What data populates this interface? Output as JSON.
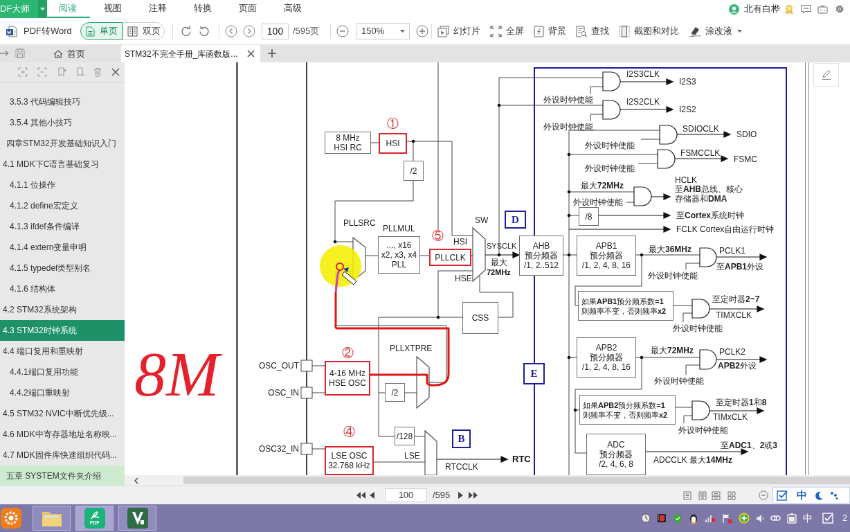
{
  "app_menu": {
    "label": "DF大师"
  },
  "menu_tabs": [
    {
      "label": "阅读",
      "selected": true
    },
    {
      "label": "视图",
      "selected": false
    },
    {
      "label": "注释",
      "selected": false
    },
    {
      "label": "转换",
      "selected": false
    },
    {
      "label": "页面",
      "selected": false
    },
    {
      "label": "高级",
      "selected": false
    }
  ],
  "account": {
    "name": "北有白桦"
  },
  "toolbar": {
    "convert_button": "PDF转Word",
    "page_layouts": [
      {
        "label": "单页",
        "selected": true
      },
      {
        "label": "双页",
        "selected": false
      }
    ],
    "page_field": {
      "value": "100"
    },
    "page_total": "/595页",
    "zoom_field": {
      "value": "150%"
    },
    "tools": [
      {
        "label": "幻灯片",
        "dropdown": false
      },
      {
        "label": "全屏",
        "dropdown": false
      },
      {
        "label": "背景",
        "dropdown": false
      },
      {
        "label": "查找",
        "dropdown": false
      },
      {
        "label": "截图和对比",
        "dropdown": false
      },
      {
        "label": "涂改液",
        "dropdown": true
      }
    ]
  },
  "tabs": [
    {
      "kind": "home",
      "label": "首页",
      "selected": false
    },
    {
      "kind": "document",
      "label": "STM32不完全手册_库函数版...",
      "selected": true
    }
  ],
  "outline": {
    "continued_items": [
      {
        "label": "3.5.3 代码编辑技巧",
        "selected": false,
        "hovered": false
      },
      {
        "label": "3.5.4 其他小技巧",
        "selected": false,
        "hovered": false
      }
    ],
    "items": [
      {
        "label": "四章STM32开发基础知识入门",
        "selected": false,
        "hovered": false,
        "children": [
          {
            "label": "4.1 MDK下C语言基础复习",
            "selected": false,
            "hovered": false,
            "children": [
              {
                "label": "4.1.1 位操作",
                "selected": false,
                "hovered": false
              },
              {
                "label": "4.1.2 define宏定义",
                "selected": false,
                "hovered": false
              },
              {
                "label": "4.1.3 ifdef条件编译",
                "selected": false,
                "hovered": false
              },
              {
                "label": "4.1.4 extern变量申明",
                "selected": false,
                "hovered": false
              },
              {
                "label": "4.1.5 typedef类型别名",
                "selected": false,
                "hovered": false
              },
              {
                "label": "4.1.6 结构体",
                "selected": false,
                "hovered": false
              }
            ]
          },
          {
            "label": "4.2 STM32系统架构",
            "selected": false,
            "hovered": false
          },
          {
            "label": "4.3 STM32时钟系统",
            "selected": true,
            "hovered": false
          },
          {
            "label": "4.4 端口复用和重映射",
            "selected": false,
            "hovered": false,
            "children": [
              {
                "label": "4.4.1端口复用功能",
                "selected": false,
                "hovered": false
              },
              {
                "label": "4.4.2端口重映射",
                "selected": false,
                "hovered": false
              }
            ]
          },
          {
            "label": "4.5 STM32 NVIC中断优先级...",
            "selected": false,
            "hovered": false
          },
          {
            "label": "4.6 MDK中寄存器地址名称映...",
            "selected": false,
            "hovered": false
          },
          {
            "label": "4.7 MDK固件库快速组织代码...",
            "selected": false,
            "hovered": false
          }
        ]
      },
      {
        "label": "五章 SYSTEM文件夹介绍",
        "selected": false,
        "hovered": true
      }
    ]
  },
  "document": {
    "ink_note": "8M",
    "clock_diagram": {
      "parts": [
        {
          "kind": "box",
          "lines": [
            "8 MHz",
            "HSI RC"
          ],
          "highlighted": false
        },
        {
          "kind": "marker",
          "text": "①"
        },
        {
          "kind": "box",
          "lines": [
            "HSI"
          ],
          "highlighted": true
        },
        {
          "kind": "box",
          "lines": [
            "/2"
          ],
          "highlighted": false
        },
        {
          "kind": "label",
          "text": "PLLSRC"
        },
        {
          "kind": "label",
          "text": "PLLMUL"
        },
        {
          "kind": "box",
          "lines": [
            "..., x16",
            "x2, x3, x4",
            "PLL"
          ],
          "highlighted": false
        },
        {
          "kind": "marker",
          "text": "⑤"
        },
        {
          "kind": "box",
          "lines": [
            "PLLCLK"
          ],
          "highlighted": true
        },
        {
          "kind": "label",
          "text": "SW"
        },
        {
          "kind": "label",
          "text": "HSI"
        },
        {
          "kind": "label",
          "text": "HSE"
        },
        {
          "kind": "label",
          "text": "SYSCLK"
        },
        {
          "kind": "label",
          "text": "最大"
        },
        {
          "kind": "strong",
          "text": "72MHz"
        },
        {
          "kind": "region",
          "text": "D"
        },
        {
          "kind": "box",
          "lines": [
            "CSS"
          ],
          "highlighted": false
        },
        {
          "kind": "marker",
          "text": "②"
        },
        {
          "kind": "pin",
          "text": "OSC_OUT"
        },
        {
          "kind": "pin",
          "text": "OSC_IN"
        },
        {
          "kind": "box",
          "lines": [
            "4-16 MHz",
            "HSE OSC"
          ],
          "highlighted": true
        },
        {
          "kind": "label",
          "text": "PLLXTPRE"
        },
        {
          "kind": "box",
          "lines": [
            "/2"
          ],
          "highlighted": false
        },
        {
          "kind": "marker",
          "text": "④"
        },
        {
          "kind": "pin",
          "text": "OSC32_IN"
        },
        {
          "kind": "box",
          "lines": [
            "LSE OSC",
            "32.768 kHz"
          ],
          "highlighted": true
        },
        {
          "kind": "box",
          "lines": [
            "/128"
          ],
          "highlighted": false
        },
        {
          "kind": "label",
          "text": "LSE"
        },
        {
          "kind": "label",
          "text": "RTCCLK"
        },
        {
          "kind": "strong",
          "text": "RTC"
        },
        {
          "kind": "region",
          "text": "B"
        },
        {
          "kind": "box",
          "lines": [
            "AHB",
            "预分频器",
            "/1, 2..512"
          ],
          "highlighted": false
        },
        {
          "kind": "region",
          "text": "E"
        },
        {
          "kind": "label",
          "text": "I2S3CLK"
        },
        {
          "kind": "label",
          "text": "I2S3"
        },
        {
          "kind": "label",
          "text": "外设时钟使能"
        },
        {
          "kind": "label",
          "text": "I2S2CLK"
        },
        {
          "kind": "label",
          "text": "I2S2"
        },
        {
          "kind": "label",
          "text": "外设时钟使能"
        },
        {
          "kind": "label",
          "text": "SDIOCLK"
        },
        {
          "kind": "label",
          "text": "SDIO"
        },
        {
          "kind": "label",
          "text": "外设时钟使能"
        },
        {
          "kind": "label",
          "text": "FSMCCLK"
        },
        {
          "kind": "label",
          "text": "FSMC"
        },
        {
          "kind": "label",
          "text": "外设时钟使能"
        },
        {
          "kind": "label",
          "text": "最大**72MHz**"
        },
        {
          "kind": "label",
          "text": "外设时钟使能"
        },
        {
          "kind": "label",
          "text": "HCLK"
        },
        {
          "kind": "label",
          "text": "至**AHB**总线、核心"
        },
        {
          "kind": "label",
          "text": "存储器和**DMA**"
        },
        {
          "kind": "box",
          "lines": [
            "/8"
          ],
          "highlighted": false
        },
        {
          "kind": "label",
          "text": "至**Cortex**系统时钟"
        },
        {
          "kind": "label",
          "text": "FCLK Cortex自由运行时钟"
        },
        {
          "kind": "box",
          "lines": [
            "APB1",
            "预分频器",
            "/1, 2, 4, 8, 16"
          ],
          "highlighted": false
        },
        {
          "kind": "label",
          "text": "最大**36MHz**"
        },
        {
          "kind": "label",
          "text": "PCLK1"
        },
        {
          "kind": "label",
          "text": "至**APB1**外设"
        },
        {
          "kind": "label",
          "text": "外设时钟使能"
        },
        {
          "kind": "box",
          "lines": [
            "如果**APB1**预分频系数**=1**",
            "则频率不变，否则频率**x2**"
          ],
          "highlighted": false
        },
        {
          "kind": "label",
          "text": "至定时器**2~7**"
        },
        {
          "kind": "label",
          "text": "TIMXCLK"
        },
        {
          "kind": "label",
          "text": "外设时钟使能"
        },
        {
          "kind": "box",
          "lines": [
            "APB2",
            "预分频器",
            "/1, 2, 4, 8, 16"
          ],
          "highlighted": false
        },
        {
          "kind": "label",
          "text": "最大**72MHz**"
        },
        {
          "kind": "label",
          "text": "PCLK2"
        },
        {
          "kind": "label",
          "text": "**APB2**外设"
        },
        {
          "kind": "label",
          "text": "外设时钟使能"
        },
        {
          "kind": "box",
          "lines": [
            "如果**APB2**预分频系数**=1**",
            "则频率不变，否则频率**x2**"
          ],
          "highlighted": false
        },
        {
          "kind": "label",
          "text": "至定时器**1**和**8**"
        },
        {
          "kind": "label",
          "text": "TIMxCLK"
        },
        {
          "kind": "label",
          "text": "外设时钟使能"
        },
        {
          "kind": "box",
          "lines": [
            "ADC",
            "预分频器",
            "/2, 4, 6, 8"
          ],
          "highlighted": false
        },
        {
          "kind": "label",
          "text": "至**ADC1**、**2**或**3**"
        },
        {
          "kind": "label",
          "text": "ADCCLK 最大**14MHz**"
        }
      ]
    }
  },
  "status_bar": {
    "page_field": {
      "value": "100"
    },
    "page_total": "/595"
  },
  "input_method": {
    "mode": "中"
  },
  "taskbar": {
    "apps": [
      {
        "kind": "media",
        "open": false,
        "active": false
      },
      {
        "kind": "files",
        "open": true,
        "active": false
      },
      {
        "kind": "pdf",
        "label": "PDF",
        "open": true,
        "active": true
      },
      {
        "kind": "editor",
        "open": true,
        "active": false
      }
    ],
    "tray": {
      "input_mode": "中",
      "clock": "2"
    }
  }
}
